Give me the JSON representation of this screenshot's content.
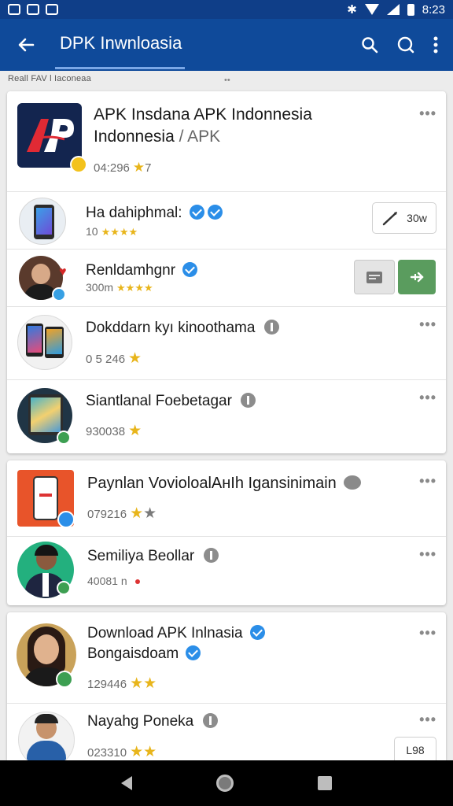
{
  "status_bar": {
    "time": "8:23"
  },
  "app_bar": {
    "title": "DPK Inwnloasia"
  },
  "subheader": {
    "label": "Reall FAV l Iaconeaa",
    "dots": "••"
  },
  "cards": [
    {
      "rows": [
        {
          "name_line1": "APK Insdana APK Indonnesia",
          "name_line2": "Indonnesia",
          "name_suffix": " / APK",
          "meta": "04:296",
          "stars": "★",
          "rating_extra": "7",
          "more": "•••"
        },
        {
          "name": "Ha dahiphmal:",
          "meta": "10",
          "stars": "★★★★",
          "button_label": "30w"
        },
        {
          "name": "Renldamhgnr",
          "meta": "300m",
          "stars": "★★★★"
        },
        {
          "name": "Dokddarn kyı kinoothama",
          "meta": "0 5 246",
          "stars": "★",
          "more": "•••"
        },
        {
          "name": "Siantlanal Foebetagar",
          "meta": "930038",
          "stars": "★",
          "more": "•••"
        }
      ]
    },
    {
      "rows": [
        {
          "name": "Paynlan VoviolоalAнIh Igansinimain",
          "meta": "079216",
          "stars": "★",
          "stars_gray": "★",
          "more": "•••"
        },
        {
          "name": "Semiliya Beollar",
          "meta": "40081 n",
          "stars": "",
          "more": "•••"
        }
      ]
    },
    {
      "rows": [
        {
          "name_line1": "Download APK Inlnasia",
          "name_line2": "Bongaisdoam",
          "meta": "129446",
          "stars": "★★",
          "more": "•••"
        },
        {
          "name": "Nayahg Poneka",
          "meta": "023310",
          "stars": "★★",
          "button_label": "L98",
          "more": "•••"
        }
      ]
    }
  ]
}
